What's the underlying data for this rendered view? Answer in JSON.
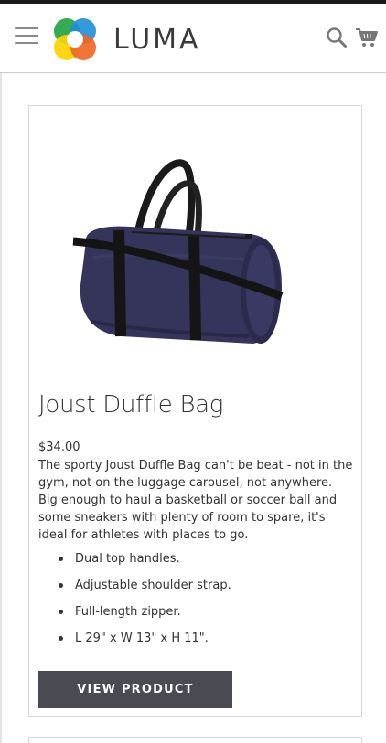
{
  "header": {
    "logo_text": "LUMA",
    "menu_icon": "hamburger-menu-icon",
    "search_icon": "search-icon",
    "cart_icon": "shopping-cart-icon"
  },
  "product": {
    "name": "Joust Duffle Bag",
    "price": "$34.00",
    "description": "The sporty Joust Duffle Bag can't be beat - not in the gym, not on the luggage carousel, not anywhere. Big enough to haul a basketball or soccer ball and some sneakers with plenty of room to spare, it's ideal for athletes with places to go.",
    "features": [
      "Dual top handles.",
      "Adjustable shoulder strap.",
      "Full-length zipper.",
      "L 29\" x W 13\" x H 11\"."
    ],
    "button_label": "VIEW PRODUCT",
    "image_alt": "duffle-bag-image"
  },
  "colors": {
    "button_bg": "#4a4a52",
    "logo_green": "#2aa84a",
    "logo_blue": "#1f8fd6",
    "logo_orange": "#f26522",
    "logo_yellow": "#ffd200"
  }
}
